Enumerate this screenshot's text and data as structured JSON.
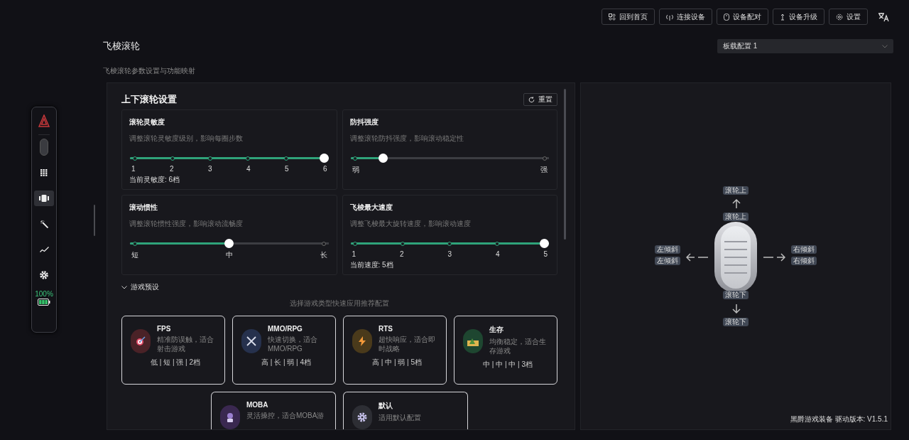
{
  "toolbar": {
    "buttons": [
      {
        "label": "回到首页",
        "kind": "home"
      },
      {
        "label": "连接设备",
        "kind": "connect"
      },
      {
        "label": "设备配对",
        "kind": "pair"
      },
      {
        "label": "设备升级",
        "kind": "upgrade"
      },
      {
        "label": "设置",
        "kind": "settings"
      }
    ]
  },
  "sidebar": {
    "items": [
      {
        "kind": "mouse",
        "selected": false
      },
      {
        "kind": "keypad",
        "selected": false
      },
      {
        "kind": "wheel",
        "selected": true
      },
      {
        "kind": "wand",
        "selected": false
      },
      {
        "kind": "chart",
        "selected": false
      },
      {
        "kind": "gear",
        "selected": false
      }
    ],
    "battery": "100%"
  },
  "page": {
    "title": "飞梭滚轮",
    "subtitle": "飞梭滚轮参数设置与功能映射",
    "profile": "板载配置 1"
  },
  "wheel_settings": {
    "title": "上下滚轮设置",
    "reset": "重置",
    "sliders": [
      {
        "title": "滚轮灵敏度",
        "description": "调整滚轮灵敏度级别，影响每圈步数",
        "labels": [
          "1",
          "2",
          "3",
          "4",
          "5",
          "6"
        ],
        "level": 1,
        "reading": "当前灵敏度: 6档"
      },
      {
        "title": "防抖强度",
        "description": "调整滚轮防抖强度，影响滚动稳定性",
        "labels": [
          "弱",
          "强"
        ],
        "level": 0.15
      },
      {
        "title": "滚动惯性",
        "description": "调整滚轮惯性强度，影响滚动流畅度",
        "labels": [
          "短",
          "中",
          "长"
        ],
        "level": 0.5
      },
      {
        "title": "飞梭最大速度",
        "description": "调整飞梭最大旋转速度，影响滚动速度",
        "labels": [
          "1",
          "2",
          "3",
          "4",
          "5"
        ],
        "level": 1,
        "reading": "当前速度: 5档"
      }
    ]
  },
  "game_presets": {
    "title": "游戏预设",
    "expanded": true,
    "hint": "选择游戏类型快速应用推荐配置",
    "presets": [
      {
        "name": "FPS",
        "description": "精准防误触，适合射击游戏",
        "values": "低 | 短 | 强 | 2档",
        "kind": "target",
        "color": "#4a2227"
      },
      {
        "name": "MMO/RPG",
        "description": "快速切换，适合MMO/RPG",
        "values": "高 | 长 | 弱 | 4档",
        "kind": "swords",
        "color": "#26314d"
      },
      {
        "name": "RTS",
        "description": "超快响应，适合即时战略",
        "values": "高 | 中 | 弱 | 5档",
        "kind": "bolt",
        "color": "#4a3a1b"
      },
      {
        "name": "生存",
        "description": "均衡稳定，适合生存游戏",
        "values": "中 | 中 | 中 | 3档",
        "kind": "tent",
        "color": "#1e4630"
      },
      {
        "name": "MOBA",
        "description": "灵活操控，适合MOBA游",
        "kind": "wizard",
        "color": "#3a2850"
      },
      {
        "name": "默认",
        "description": "适用默认配置",
        "kind": "gear",
        "color": "#2d2e34"
      }
    ]
  },
  "wheel_map": {
    "up_action": "滚轮上",
    "up_key": "滚轮上",
    "left_action": "左倾斜",
    "left_key": "左倾斜",
    "right_action": "右倾斜",
    "right_key": "右倾斜",
    "down_key": "滚轮下",
    "down_action": "滚轮下"
  },
  "footer": "黑爵游戏装备 驱动版本: V1.5.1"
}
